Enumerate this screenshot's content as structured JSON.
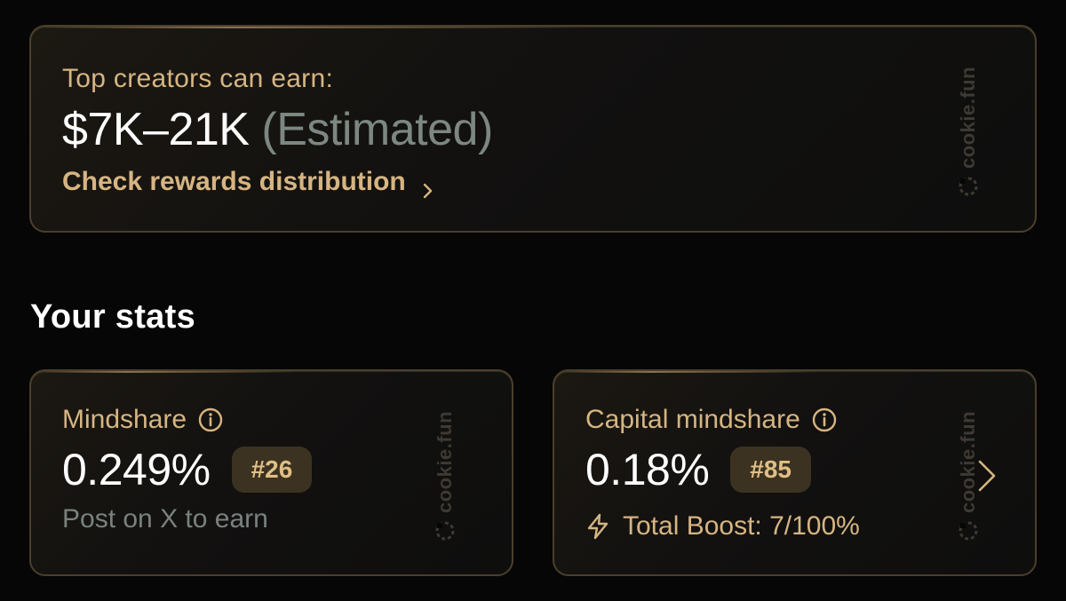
{
  "rewards": {
    "label": "Top creators can earn:",
    "amount": "$7K–21K",
    "estimated": "(Estimated)",
    "link_label": "Check rewards distribution",
    "link_icon": "chevron-right-icon"
  },
  "watermark": {
    "text": "cookie.fun",
    "icon": "cookie-icon"
  },
  "stats": {
    "title": "Your stats",
    "mindshare": {
      "label": "Mindshare",
      "info_icon": "info-icon",
      "value": "0.249%",
      "rank": "#26",
      "hint": "Post on X to earn"
    },
    "capital_mindshare": {
      "label": "Capital mindshare",
      "info_icon": "info-icon",
      "value": "0.18%",
      "rank": "#85",
      "boost_icon": "lightning-icon",
      "boost_label": "Total Boost: 7/100%",
      "nav_icon": "chevron-right-icon"
    }
  },
  "colors": {
    "background": "#060606",
    "accent_gold": "#d6b582",
    "badge_bg": "#3b3221",
    "muted_text": "#79827e",
    "card_border": "#4a3f2c"
  }
}
